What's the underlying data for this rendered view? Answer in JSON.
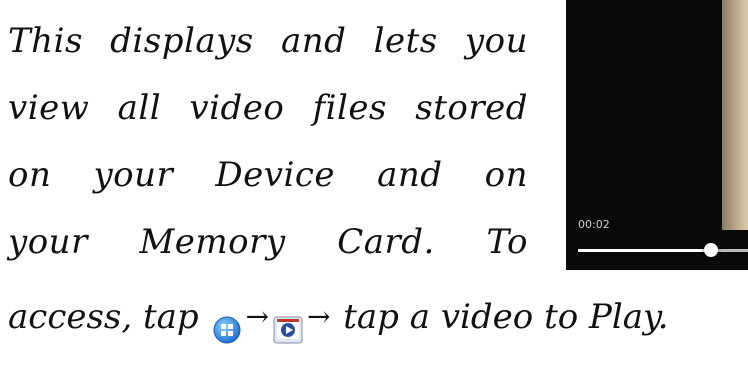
{
  "document": {
    "lines": [
      "This displays and lets you",
      "view all video files stored",
      "on your Device and on",
      "your Memory Card. To"
    ],
    "last_line_prefix": "access, tap ",
    "arrow": "→",
    "last_line_suffix": " tap a video to Play."
  },
  "player": {
    "current_time": "00:02",
    "progress": 0.78
  },
  "icons": {
    "apps": "apps-grid-icon",
    "video": "video-player-app-icon"
  }
}
